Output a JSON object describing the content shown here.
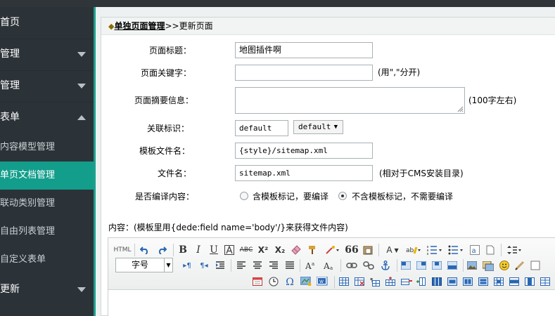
{
  "sidebar": {
    "items": [
      {
        "label": "首页",
        "kind": "top",
        "caret": ""
      },
      {
        "label": "管理",
        "kind": "top",
        "caret": "down"
      },
      {
        "label": "管理",
        "kind": "top",
        "caret": "down"
      },
      {
        "label": "表单",
        "kind": "top",
        "caret": "up"
      },
      {
        "label": "内容模型管理",
        "kind": "sub"
      },
      {
        "label": "单页文档管理",
        "kind": "sub",
        "active": true
      },
      {
        "label": "联动类别管理",
        "kind": "sub"
      },
      {
        "label": "自由列表管理",
        "kind": "sub"
      },
      {
        "label": "自定义表单",
        "kind": "sub"
      },
      {
        "label": "更新",
        "kind": "top",
        "caret": "down"
      }
    ]
  },
  "breadcrumb": {
    "marker": "◆",
    "link": "单独页面管理",
    "separator": ">>",
    "current": "更新页面"
  },
  "form": {
    "title": {
      "label": "页面标题：",
      "value": "地图插件啊"
    },
    "keywords": {
      "label": "页面关键字：",
      "value": "",
      "hint": "(用\",\"分开)"
    },
    "summary": {
      "label": "页面摘要信息：",
      "value": "",
      "hint": "(100字左右)"
    },
    "tag": {
      "label": "关联标识：",
      "value": "default",
      "select": "default"
    },
    "template": {
      "label": "模板文件名：",
      "value": "{style}/sitemap.xml"
    },
    "filename": {
      "label": "文件名：",
      "value": "sitemap.xml",
      "hint": "(相对于CMS安装目录)"
    },
    "compile": {
      "label": "是否编译内容：",
      "options": [
        {
          "label": "含模板标记，要编译",
          "checked": false
        },
        {
          "label": "不含模板标记，不需要编译",
          "checked": true
        }
      ]
    },
    "content_label": "内容：(模板里用{dede:field name='body'/}来获得文件内容)"
  },
  "editor": {
    "font_size_label": "字号",
    "html_label": "HTML",
    "bold": "B",
    "italic": "I",
    "underline": "U",
    "strike": "ABC",
    "superscript": "X²",
    "subscript": "X₂",
    "quote": "66",
    "font_color": "A",
    "ltr": "▸¶",
    "rtl": "¶◂"
  },
  "colors": {
    "sidebar_bg": "#2c3338",
    "active_bg": "#139e8c",
    "teal_line": "#1ea08e",
    "content_bg": "#eef1f1"
  }
}
